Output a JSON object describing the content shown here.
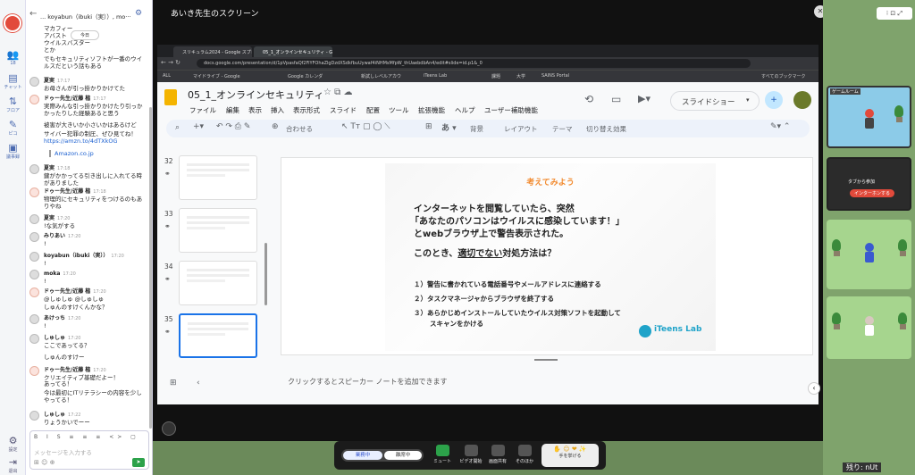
{
  "left_rail": {
    "count": "18",
    "items": [
      "チャット",
      "フロア",
      "ピコ",
      "議事録"
    ],
    "settings": "設定",
    "exit": "退出"
  },
  "chat": {
    "channel_title": "... koyabun（ibuki（実））, mo···",
    "today_badge": "今日",
    "messages": [
      {
        "user": "",
        "time": "",
        "text": "マカフィー"
      },
      {
        "user": "",
        "time": "",
        "text": "アバスト"
      },
      {
        "user": "",
        "time": "",
        "text": "ウイルスバスター"
      },
      {
        "user": "",
        "time": "",
        "text": "とか"
      },
      {
        "user": "",
        "time": "",
        "text": "でもセキュリティソフトが一番のウイルスだという話もある"
      },
      {
        "user": "夏実",
        "time": "17:17",
        "text": "お母さんが引っ掛かりかけてた"
      },
      {
        "user": "ドゥー先生/近藤 楷",
        "time": "17:17",
        "text": "実際みんな引っ掛かりかけたり引っかかったりした経験あると思う"
      },
      {
        "user": "",
        "time": "",
        "text": "被害が大きいか小さいかはあるけど"
      },
      {
        "user": "",
        "time": "",
        "text": "サイバー犯罪の制圧、ぜひ見てね！"
      },
      {
        "user": "",
        "time": "",
        "text": "https://amzn.to/4dTXkOG"
      },
      {
        "user": "",
        "time": "",
        "text": "Amazon.co.jp"
      },
      {
        "user": "夏実",
        "time": "17:18",
        "text": "鍵がかかってる引き出しに入れてる時がありました"
      },
      {
        "user": "ドゥー先生/近藤 楷",
        "time": "17:18",
        "text": "物理的にセキュリティをつけるのもありやね"
      },
      {
        "user": "夏実",
        "time": "17:20",
        "text": "!な気がする"
      },
      {
        "user": "みりあい",
        "time": "17:20",
        "text": "!"
      },
      {
        "user": "koyabun（ibuki（実））",
        "time": "17:20",
        "text": "!"
      },
      {
        "user": "moka",
        "time": "17:20",
        "text": "!"
      },
      {
        "user": "ドゥー先生/近藤 楷",
        "time": "17:20",
        "text": "@しゅしゅ @しゅしゅ"
      },
      {
        "user": "",
        "time": "",
        "text": "しゅんのすけくんかな？"
      },
      {
        "user": "あけっち",
        "time": "17:20",
        "text": "!"
      },
      {
        "user": "しゅしゅ",
        "time": "17:20",
        "text": "ここであってる？"
      },
      {
        "user": "",
        "time": "",
        "text": "しゅんのすけー"
      },
      {
        "user": "ドゥー先生/近藤 楷",
        "time": "17:20",
        "text": "クリエイティブ基礎だよー！"
      },
      {
        "user": "",
        "time": "",
        "text": "あってる！"
      },
      {
        "user": "",
        "time": "",
        "text": "今は最初にITリテラシーの内容を少しやってる！"
      },
      {
        "user": "しゅしゅ",
        "time": "17:22",
        "text": "りょうかいでーー"
      }
    ],
    "input_placeholder": "メッセージを入力する"
  },
  "screen_share": {
    "title": "あいき先生のスクリーン",
    "browser_tabs": [
      "スリキュラム2024 - Google スプレ",
      "05_1_オンラインセキュリティ - Goo"
    ],
    "url": "docs.google.com/presentation/d/1pVpasfaQf2FiYFOhaZlgDzdXSdkfbuUywaf4iNHMsMfpW_thUaebdbAn4/edit#slide=id.p1&_0",
    "bookmarks": [
      "ALL",
      "マイドライブ - Google",
      "Google カレンダ",
      "新試しレベルアカウ",
      "iTeens Lab",
      "課題",
      "大学",
      "SAINS Portal",
      "すべてのブックマーク"
    ],
    "doc_title": "05_1_オンラインセキュリティ",
    "menu": [
      "ファイル",
      "編集",
      "表示",
      "挿入",
      "表示形式",
      "スライド",
      "配置",
      "ツール",
      "拡張機能",
      "ヘルプ",
      "ユーザー補助機能"
    ],
    "slideshow_button": "スライドショー",
    "toolbar": {
      "zoom": "合わせる",
      "background": "背景",
      "layout": "レイアウト",
      "theme": "テーマ",
      "transition": "切り替え効果"
    },
    "thumbnails": [
      "32",
      "33",
      "34",
      "35"
    ],
    "slide": {
      "heading": "考えてみよう",
      "question_1": "インターネットを閲覧していたら、突然",
      "question_2": "「あなたのパソコンはウイルスに感染しています！」",
      "question_3": "とwebブラウザ上で警告表示された。",
      "question_4a": "このとき、",
      "question_4b": "適切でない",
      "question_4c": "対処方法は？",
      "options": [
        "１）警告に書かれている電話番号やメールアドレスに連絡する",
        "２）タスクマネージャからブラウザを終了する",
        "３）あらかじめインストールしていたウイルス対策ソフトを起動して"
      ],
      "option_3_cont": "スキャンをかける",
      "logo": "iTeens Lab"
    },
    "speaker_notes": "クリックするとスピーカー ノートを追加できます"
  },
  "bottom_bar": {
    "status_on": "業務中",
    "status_off": "離席中",
    "mute": "ミュート",
    "video": "ビデオ開始",
    "share": "画面共有",
    "other": "そのほか",
    "raise_hand": "手を挙げる"
  },
  "right_pane": {
    "room_label": "ゲームルーム",
    "tablet_text": "タブから参加",
    "interview_button": "インターホンする",
    "footer_label": "残り: nUt"
  },
  "colors": {
    "accent": "#f28b30",
    "blue": "#1a73e8",
    "red_text": "#d63a2a"
  }
}
